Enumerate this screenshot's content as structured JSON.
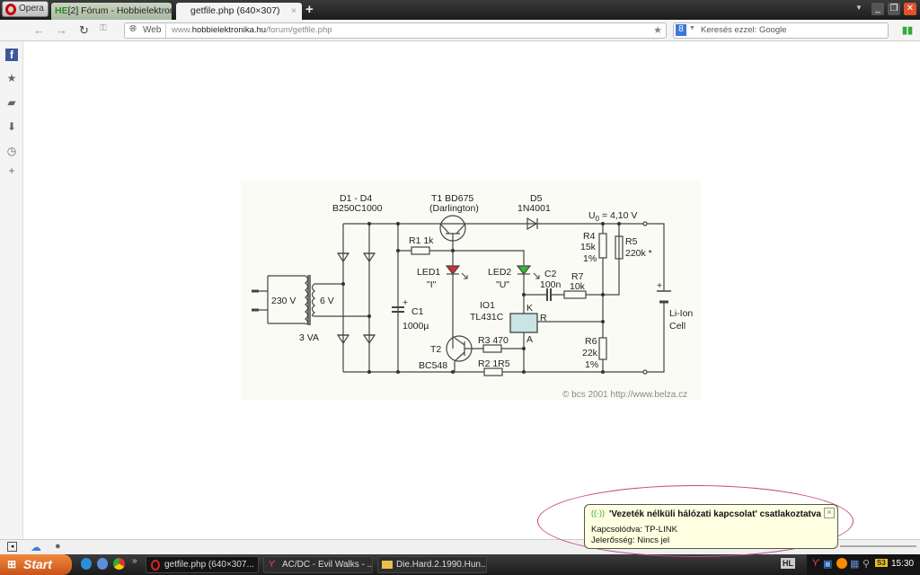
{
  "browser": {
    "menu_label": "Opera",
    "tabs": [
      {
        "badge": "HE",
        "label": "[2] Fórum - Hobbielektroni...",
        "close": "×"
      },
      {
        "label": "getfile.php (640×307)",
        "close": "×"
      }
    ],
    "new_tab": "+",
    "web_label": "Web",
    "url_host": "www.hobbielektronika.hu",
    "url_prefix": "www.",
    "url_domain": "hobbielektronika.hu",
    "url_path": "/forum/getfile.php",
    "search_placeholder": "Keresés ezzel: Google",
    "search_engine_badge": "8"
  },
  "schematic": {
    "d1d4": "D1 - D4",
    "bridge": "B250C1000",
    "t1": "T1  BD675",
    "t1_note": "(Darlington)",
    "d5": "D5",
    "d5_part": "1N4001",
    "uo": "U",
    "uo_sub": "0",
    "uo_val": " = 4,10 V",
    "r1": "R1  1k",
    "led1": "LED1",
    "led1_q": "\"I\"",
    "led2": "LED2",
    "led2_q": "\"U\"",
    "c2": "C2",
    "c2v": "100n",
    "r7": "R7",
    "r7v": "10k",
    "r4": "R4",
    "r4v": "15k",
    "r4t": "1%",
    "r5": "R5",
    "r5v": "220k *",
    "io1": "IO1",
    "io1p": "TL431C",
    "k": "K",
    "r": "R",
    "a": "A",
    "c1": "C1",
    "c1v": "1000µ",
    "v230": "230 V",
    "v6": "6 V",
    "va": "3 VA",
    "t2": "T2",
    "t2p": "BC548",
    "r3": "R3  470",
    "r2": "R2  1R5",
    "r6": "R6",
    "r6v": "22k",
    "r6t": "1%",
    "cell1": "Li-Ion",
    "cell2": "Cell",
    "plus": "+",
    "credit": "© bcs 2001   http://www.belza.cz"
  },
  "notification": {
    "title": "'Vezeték nélküli hálózati kapcsolat'  csatlakoztatva",
    "line1": "Kapcsolódva: TP-LINK",
    "line2": "Jelerősség: Nincs jel",
    "close": "×"
  },
  "taskbar": {
    "start": "Start",
    "more": "»",
    "items": [
      {
        "label": "getfile.php (640×307..."
      },
      {
        "label": "AC/DC - Evil Walks - ..."
      },
      {
        "label": "Die.Hard.2.1990.Hun..."
      }
    ],
    "lang": "HL",
    "tray_badge": "S3",
    "clock": "15:30"
  },
  "colors": {
    "led1": "#cc3333",
    "led2": "#33bb33",
    "ic": "#c8e4e4",
    "close": "#e0522a",
    "annotation": "#c2457e"
  }
}
